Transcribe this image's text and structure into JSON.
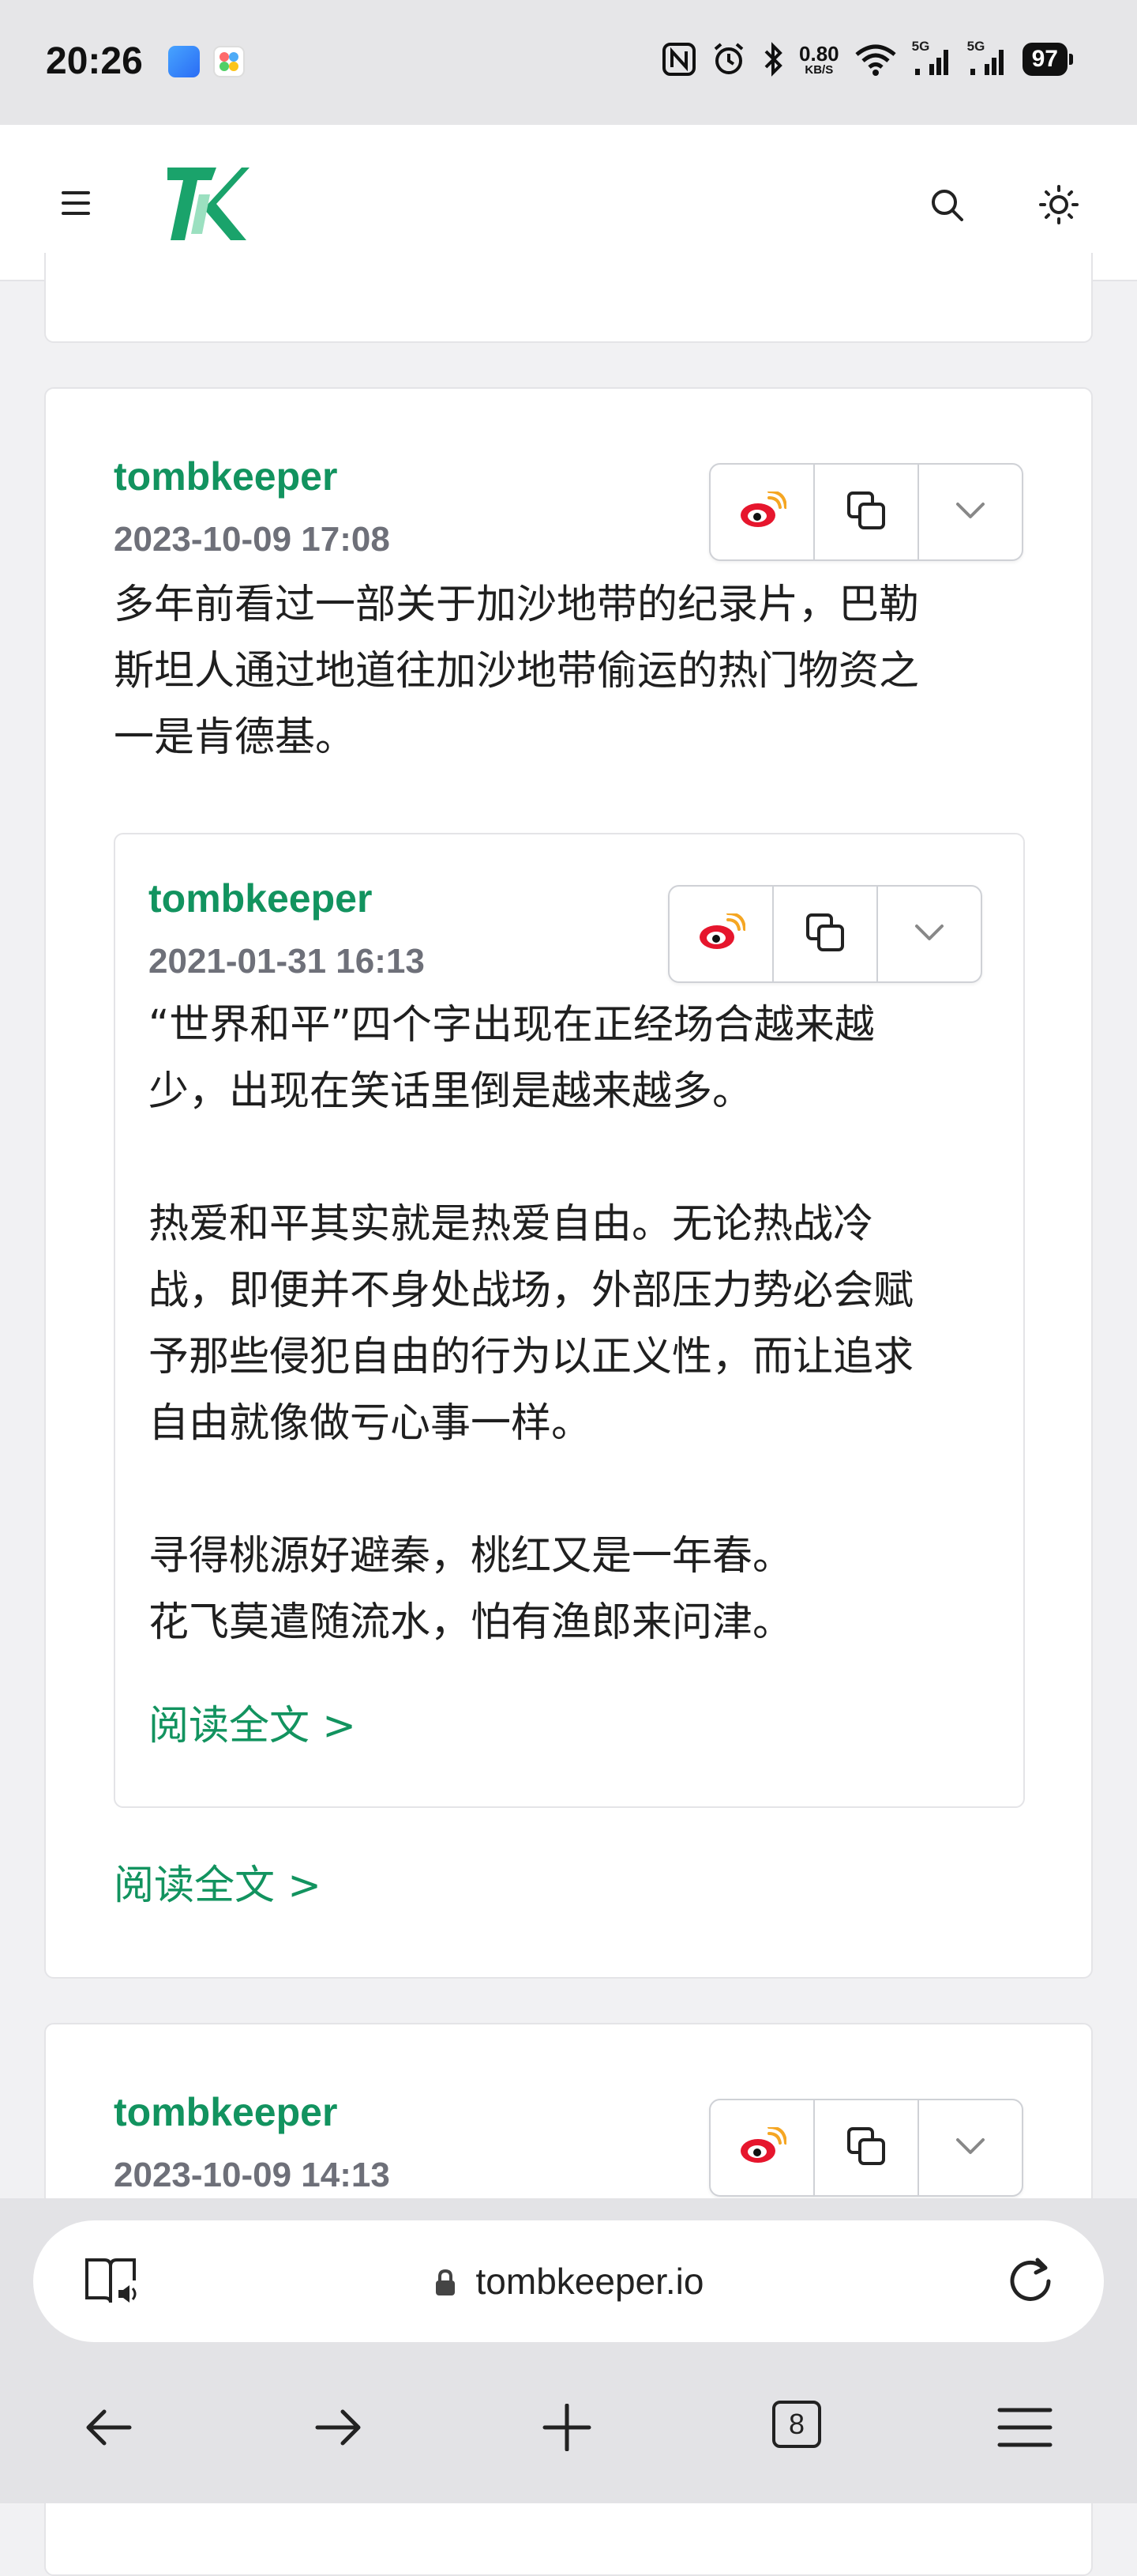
{
  "status_bar": {
    "time": "20:26",
    "net_speed": "0.80",
    "net_unit": "KB/S",
    "signal1": "5G",
    "signal2": "5G",
    "battery": "97"
  },
  "header": {
    "logo_icon": "tk-logo",
    "menu_icon": "hamburger-icon",
    "search_icon": "search-icon",
    "theme_icon": "sun-icon"
  },
  "posts": [
    {
      "author": "tombkeeper",
      "date": "2023-10-09 17:08",
      "text": "多年前看过一部关于加沙地带的纪录片，巴勒\n斯坦人通过地道往加沙地带偷运的热门物资之\n一是肯德基。",
      "read_more": "阅读全文 >",
      "quote": {
        "author": "tombkeeper",
        "date": "2021-01-31 16:13",
        "text": "“世界和平”四个字出现在正经场合越来越\n少，出现在笑话里倒是越来越多。\n\n热爱和平其实就是热爱自由。无论热战冷\n战，即便并不身处战场，外部压力势必会赋\n予那些侵犯自由的行为以正义性，而让追求\n自由就像做亏心事一样。\n\n寻得桃源好避秦，桃红又是一年春。\n花飞莫遣随流水，怕有渔郎来问津。",
        "read_more": "阅读全文 >"
      }
    },
    {
      "author": "tombkeeper",
      "date": "2023-10-09 14:13"
    }
  ],
  "browser": {
    "url": "tombkeeper.io",
    "tabs_count": "8"
  },
  "colors": {
    "accent": "#12935f",
    "date_gray": "#6e7079",
    "border": "#e4e4e7"
  }
}
